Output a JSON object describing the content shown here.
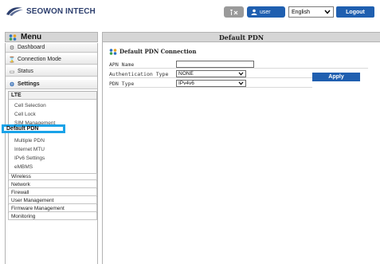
{
  "header": {
    "brand": "SEOWON INTECH",
    "user_label": "user",
    "language": "English",
    "logout_label": "Logout"
  },
  "menu": {
    "title": "Menu",
    "items_top": [
      {
        "label": "Dashboard",
        "icon": "gear-icon"
      },
      {
        "label": "Connection Mode",
        "icon": "hourglass-icon"
      },
      {
        "label": "Status",
        "icon": "monitor-icon"
      },
      {
        "label": "Settings",
        "icon": "settings-icon"
      }
    ],
    "lte": {
      "label": "LTE",
      "children": [
        "Cell Selection",
        "Cell Lock",
        "SIM Management",
        "Default PDN",
        "Multiple PDN",
        "Internet MTU",
        "IPv6 Settings",
        "eMBMS"
      ]
    },
    "items_bottom": [
      "Wireless",
      "Network",
      "Firewall",
      "User Management",
      "Firmware Management",
      "Monitoring"
    ]
  },
  "page": {
    "title": "Default PDN",
    "section_title": "Default PDN Connection",
    "fields": {
      "apn_label": "APN Name",
      "apn_value": "",
      "auth_label": "Authentication Type",
      "auth_value": "NONE",
      "pdn_label": "PDN Type",
      "pdn_value": "IPv4v6"
    },
    "apply_label": "Apply"
  },
  "colors": {
    "accent": "#1f5fb0",
    "selection": "#1aa3e8"
  }
}
